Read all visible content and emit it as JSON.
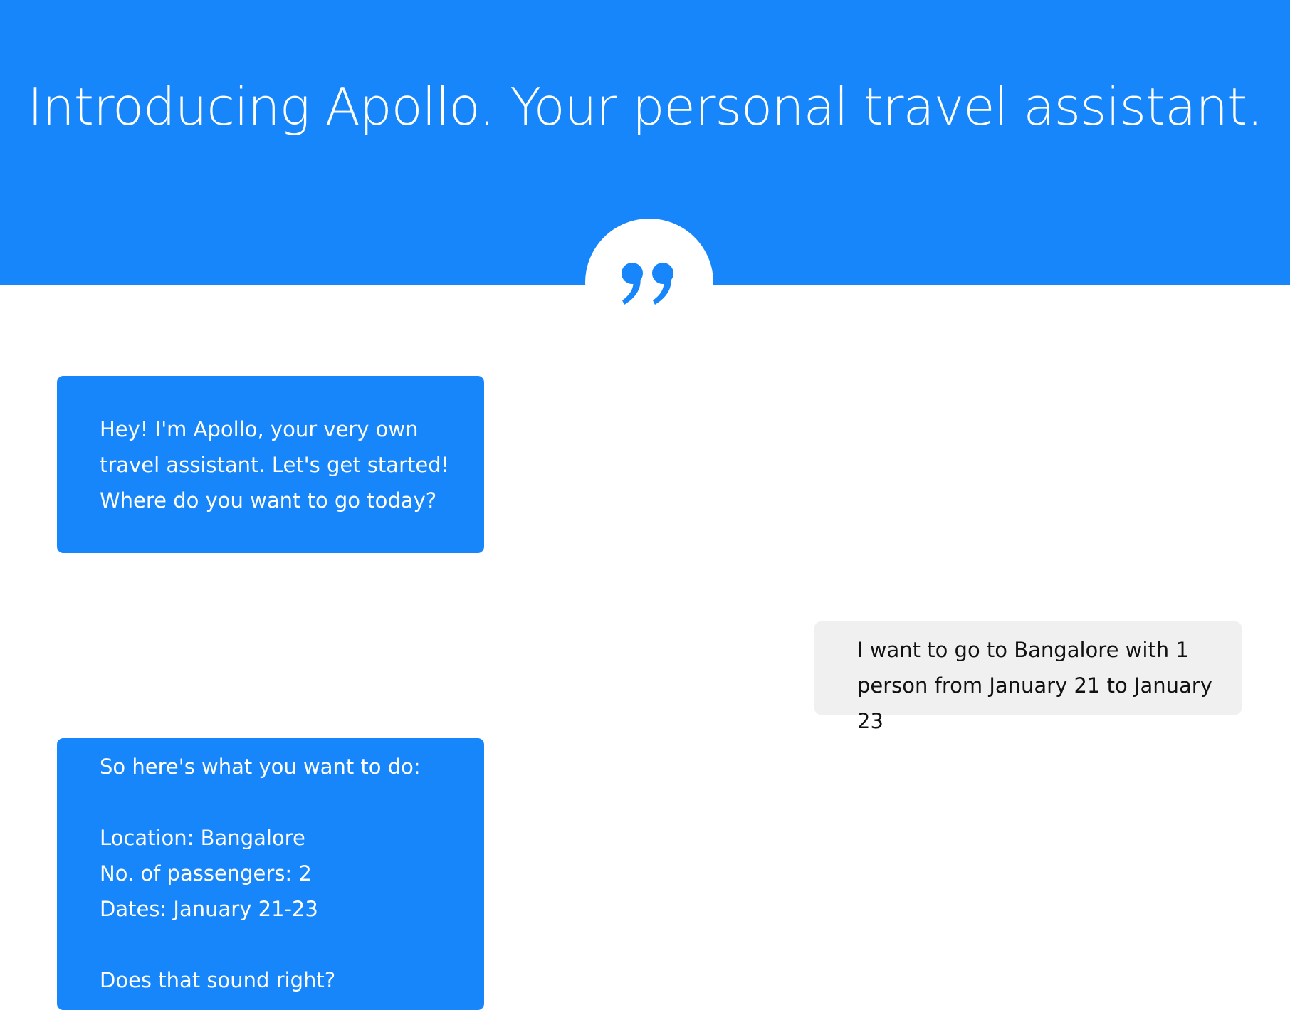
{
  "header": {
    "title": "Introducing Apollo. Your personal travel assistant.",
    "badge_icon": "quote-icon"
  },
  "colors": {
    "brand_blue": "#1886fb",
    "user_bubble": "#f0f0f0",
    "page_background": "#ffffff"
  },
  "conversation": {
    "messages": [
      {
        "sender": "assistant",
        "text": "Hey! I'm Apollo, your very own travel assistant. Let's get started!\nWhere do you want to go today?"
      },
      {
        "sender": "user",
        "text": "I want to go to Bangalore with 1 person from January 21 to January 23"
      },
      {
        "sender": "assistant",
        "text": "So here's what you want to do:\n\nLocation: Bangalore\nNo. of passengers: 2\nDates: January 21-23\n\nDoes that sound right?"
      }
    ]
  }
}
